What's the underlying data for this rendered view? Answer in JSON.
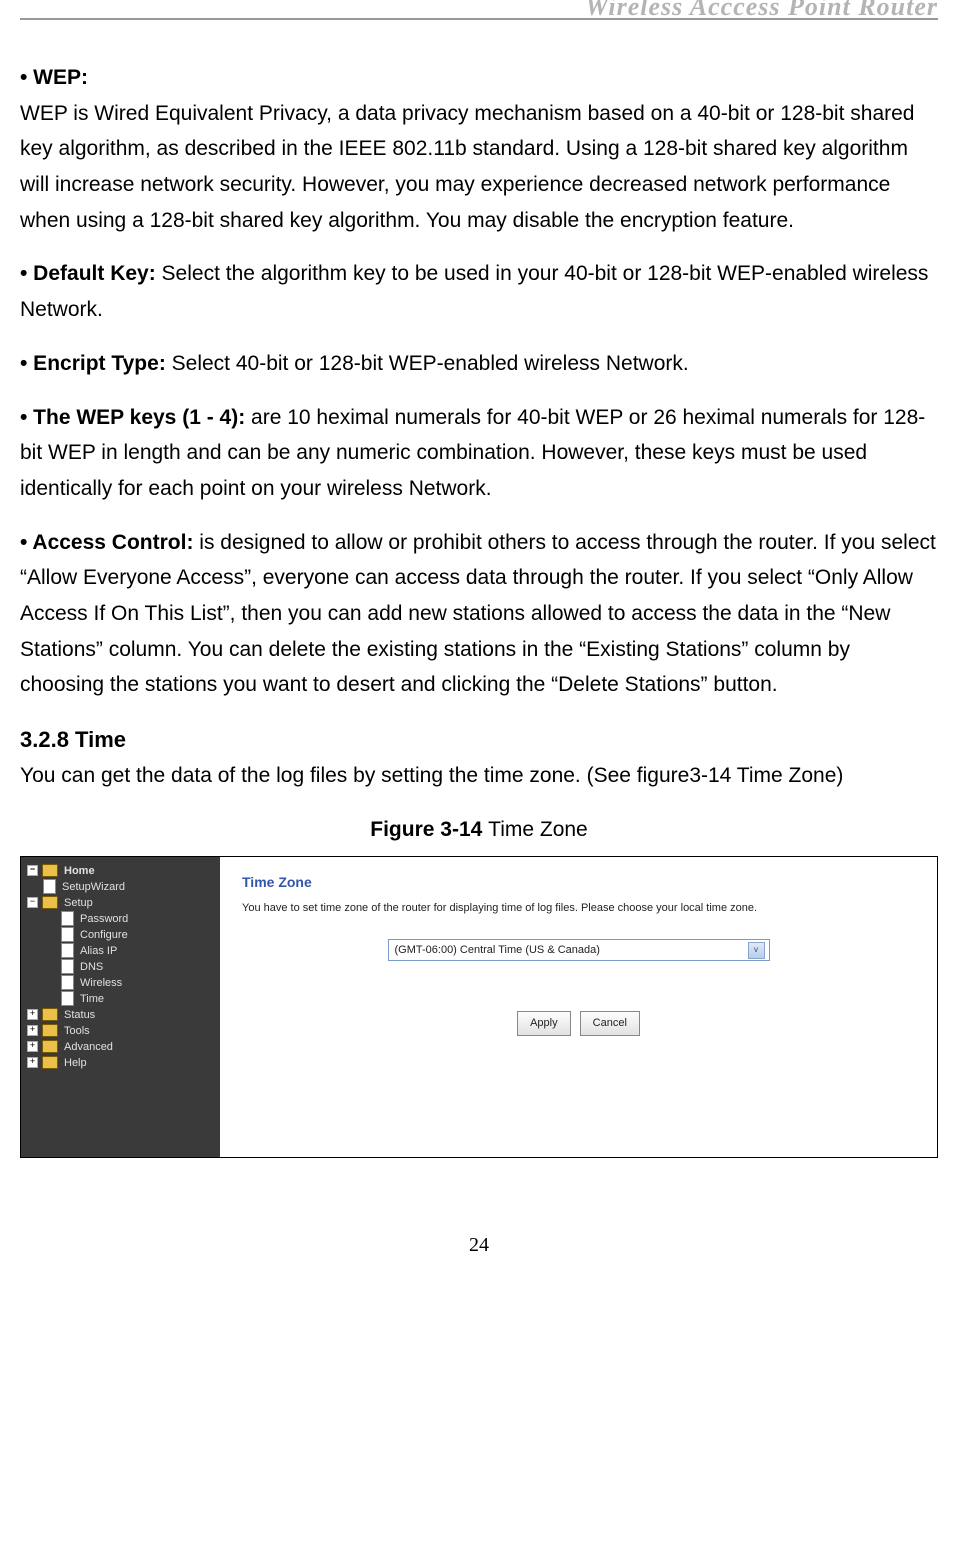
{
  "header": {
    "title": "Wireless  Acccess  Point  Router"
  },
  "sections": {
    "wep_label": "• WEP:",
    "wep_body": "WEP is Wired Equivalent Privacy, a data privacy mechanism based on a 40-bit or 128-bit shared key algorithm, as described in the IEEE 802.11b standard. Using a 128-bit shared key algorithm will increase network security. However, you may experience decreased network performance when using a 128-bit shared key algorithm. You may disable the encryption feature.",
    "defkey_label": "• Default Key: ",
    "defkey_body": "Select the algorithm key to be used in your 40-bit or 128-bit WEP-enabled wireless Network.",
    "enc_label": "• Encript Type: ",
    "enc_body": "Select 40-bit or 128-bit WEP-enabled wireless Network.",
    "keys_label": "• The WEP keys (1 - 4): ",
    "keys_body": "are 10 heximal numerals for 40-bit WEP or 26 heximal numerals for 128-bit WEP in length and can be any numeric combination. However, these keys must be used identically for each point on your wireless Network.",
    "access_label": "• Access Control: ",
    "access_body": "is designed to allow or prohibit others to access through the router. If you select “Allow Everyone Access”, everyone can access data through the router. If you select “Only Allow Access If On This List”, then you can add new stations allowed to access the data in the “New Stations” column. You can delete the existing stations in the “Existing Stations” column by choosing the stations you want to desert and clicking the “Delete Stations” button.",
    "time_heading": "3.2.8 Time",
    "time_body": "You can get the data of the log files by setting the time zone. (See figure3-14 Time Zone)"
  },
  "figure": {
    "caption_bold": "Figure 3-14 ",
    "caption_rest": "Time Zone",
    "nav": {
      "home": "Home",
      "setup": "Setup",
      "setup2": "Setup",
      "items": [
        "Password",
        "Configure",
        "Alias IP",
        "DNS",
        "Wireless",
        "Time"
      ],
      "status": "Status",
      "tools": "Tools",
      "advanced": "Advanced",
      "help": "Help"
    },
    "panel": {
      "title": "Time Zone",
      "desc": "You have to set time zone of the router for displaying time of log files.  Please choose your local time zone.",
      "selected": "(GMT-06:00) Central Time (US & Canada)",
      "apply": "Apply",
      "cancel": "Cancel"
    }
  },
  "page_number": "24",
  "glyphs": {
    "minus": "−",
    "plus": "+",
    "down": "v"
  }
}
